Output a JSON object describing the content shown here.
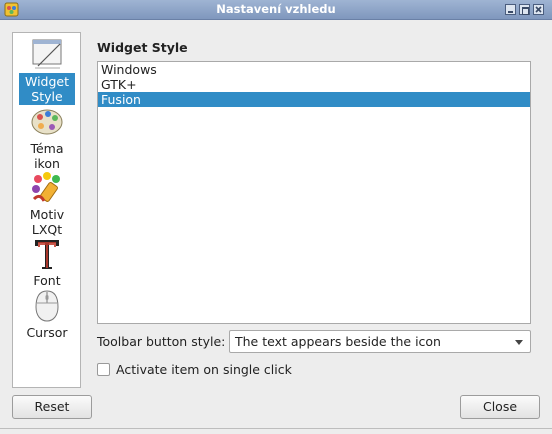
{
  "window": {
    "title": "Nastavení vzhledu",
    "controls": [
      "minimize-icon",
      "maximize-icon",
      "close-icon"
    ]
  },
  "sidebar": {
    "items": [
      {
        "label": "Widget\nStyle",
        "icon": "widget-style-icon",
        "selected": true
      },
      {
        "label": "Téma\nikon",
        "icon": "icon-theme-icon",
        "selected": false
      },
      {
        "label": "Motiv\nLXQt",
        "icon": "lxqt-theme-icon",
        "selected": false
      },
      {
        "label": "Font",
        "icon": "font-icon",
        "selected": false
      },
      {
        "label": "Cursor",
        "icon": "cursor-icon",
        "selected": false
      }
    ]
  },
  "main": {
    "heading": "Widget Style",
    "styles": [
      {
        "label": "Windows",
        "selected": false
      },
      {
        "label": "GTK+",
        "selected": false
      },
      {
        "label": "Fusion",
        "selected": true
      }
    ],
    "toolbar_label": "Toolbar button style:",
    "toolbar_value": "The text appears beside the icon",
    "single_click_label": "Activate item on single click",
    "single_click_checked": false
  },
  "buttons": {
    "reset": "Reset",
    "close": "Close"
  },
  "colors": {
    "selection": "#308cc6",
    "titlebar": "#8ea5c8"
  }
}
